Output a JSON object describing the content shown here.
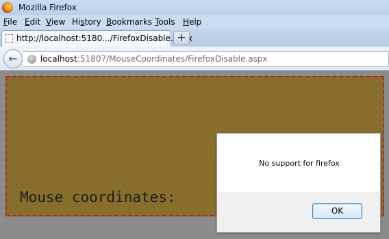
{
  "window": {
    "title": "Mozilla Firefox"
  },
  "menu": {
    "file": {
      "key": "F",
      "rest": "ile"
    },
    "edit": {
      "key": "E",
      "rest": "dit"
    },
    "view": {
      "key": "V",
      "rest": "iew"
    },
    "history": {
      "pre": "Hi",
      "key": "s",
      "rest": "tory"
    },
    "bookmarks": {
      "key": "B",
      "rest": "ookmarks"
    },
    "tools": {
      "key": "T",
      "rest": "ools"
    },
    "help": {
      "key": "H",
      "rest": "elp"
    }
  },
  "tab": {
    "title": "http://localhost:5180.../FirefoxDisable.aspx",
    "new_tab_label": "+"
  },
  "nav": {
    "back_glyph": "←",
    "url_host": "localhost",
    "url_rest": ":51807/MouseCoordinates/FirefoxDisable.aspx"
  },
  "page": {
    "coords_label": "Mouse coordinates:"
  },
  "dialog": {
    "message": "No support for firefox",
    "ok_label": "OK"
  },
  "icons": {
    "browser": "firefox-icon",
    "page": "page-icon",
    "back": "back-arrow-icon",
    "site": "globe-icon"
  }
}
